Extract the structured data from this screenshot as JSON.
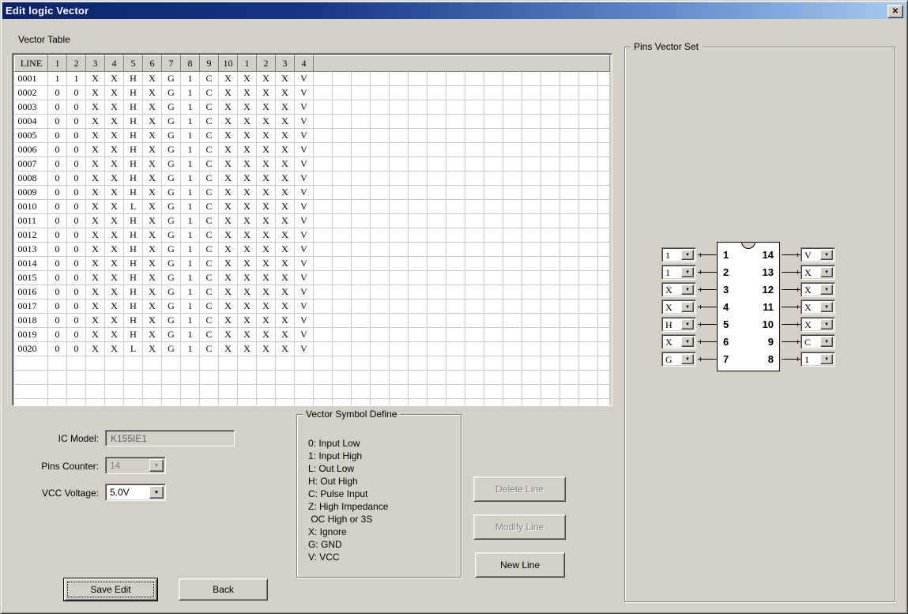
{
  "window": {
    "title": "Edit logic Vector",
    "close_label": "✕"
  },
  "vector_table": {
    "label": "Vector Table",
    "headers": [
      "LINE",
      "1",
      "2",
      "3",
      "4",
      "5",
      "6",
      "7",
      "8",
      "9",
      "10",
      "1",
      "2",
      "3",
      "4"
    ],
    "rows": [
      {
        "line": "0001",
        "values": [
          "1",
          "1",
          "X",
          "X",
          "H",
          "X",
          "G",
          "1",
          "C",
          "X",
          "X",
          "X",
          "X",
          "V"
        ]
      },
      {
        "line": "0002",
        "values": [
          "0",
          "0",
          "X",
          "X",
          "H",
          "X",
          "G",
          "1",
          "C",
          "X",
          "X",
          "X",
          "X",
          "V"
        ]
      },
      {
        "line": "0003",
        "values": [
          "0",
          "0",
          "X",
          "X",
          "H",
          "X",
          "G",
          "1",
          "C",
          "X",
          "X",
          "X",
          "X",
          "V"
        ]
      },
      {
        "line": "0004",
        "values": [
          "0",
          "0",
          "X",
          "X",
          "H",
          "X",
          "G",
          "1",
          "C",
          "X",
          "X",
          "X",
          "X",
          "V"
        ]
      },
      {
        "line": "0005",
        "values": [
          "0",
          "0",
          "X",
          "X",
          "H",
          "X",
          "G",
          "1",
          "C",
          "X",
          "X",
          "X",
          "X",
          "V"
        ]
      },
      {
        "line": "0006",
        "values": [
          "0",
          "0",
          "X",
          "X",
          "H",
          "X",
          "G",
          "1",
          "C",
          "X",
          "X",
          "X",
          "X",
          "V"
        ]
      },
      {
        "line": "0007",
        "values": [
          "0",
          "0",
          "X",
          "X",
          "H",
          "X",
          "G",
          "1",
          "C",
          "X",
          "X",
          "X",
          "X",
          "V"
        ]
      },
      {
        "line": "0008",
        "values": [
          "0",
          "0",
          "X",
          "X",
          "H",
          "X",
          "G",
          "1",
          "C",
          "X",
          "X",
          "X",
          "X",
          "V"
        ]
      },
      {
        "line": "0009",
        "values": [
          "0",
          "0",
          "X",
          "X",
          "H",
          "X",
          "G",
          "1",
          "C",
          "X",
          "X",
          "X",
          "X",
          "V"
        ]
      },
      {
        "line": "0010",
        "values": [
          "0",
          "0",
          "X",
          "X",
          "L",
          "X",
          "G",
          "1",
          "C",
          "X",
          "X",
          "X",
          "X",
          "V"
        ]
      },
      {
        "line": "0011",
        "values": [
          "0",
          "0",
          "X",
          "X",
          "H",
          "X",
          "G",
          "1",
          "C",
          "X",
          "X",
          "X",
          "X",
          "V"
        ]
      },
      {
        "line": "0012",
        "values": [
          "0",
          "0",
          "X",
          "X",
          "H",
          "X",
          "G",
          "1",
          "C",
          "X",
          "X",
          "X",
          "X",
          "V"
        ]
      },
      {
        "line": "0013",
        "values": [
          "0",
          "0",
          "X",
          "X",
          "H",
          "X",
          "G",
          "1",
          "C",
          "X",
          "X",
          "X",
          "X",
          "V"
        ]
      },
      {
        "line": "0014",
        "values": [
          "0",
          "0",
          "X",
          "X",
          "H",
          "X",
          "G",
          "1",
          "C",
          "X",
          "X",
          "X",
          "X",
          "V"
        ]
      },
      {
        "line": "0015",
        "values": [
          "0",
          "0",
          "X",
          "X",
          "H",
          "X",
          "G",
          "1",
          "C",
          "X",
          "X",
          "X",
          "X",
          "V"
        ]
      },
      {
        "line": "0016",
        "values": [
          "0",
          "0",
          "X",
          "X",
          "H",
          "X",
          "G",
          "1",
          "C",
          "X",
          "X",
          "X",
          "X",
          "V"
        ]
      },
      {
        "line": "0017",
        "values": [
          "0",
          "0",
          "X",
          "X",
          "H",
          "X",
          "G",
          "1",
          "C",
          "X",
          "X",
          "X",
          "X",
          "V"
        ]
      },
      {
        "line": "0018",
        "values": [
          "0",
          "0",
          "X",
          "X",
          "H",
          "X",
          "G",
          "1",
          "C",
          "X",
          "X",
          "X",
          "X",
          "V"
        ]
      },
      {
        "line": "0019",
        "values": [
          "0",
          "0",
          "X",
          "X",
          "H",
          "X",
          "G",
          "1",
          "C",
          "X",
          "X",
          "X",
          "X",
          "V"
        ]
      },
      {
        "line": "0020",
        "values": [
          "0",
          "0",
          "X",
          "X",
          "L",
          "X",
          "G",
          "1",
          "C",
          "X",
          "X",
          "X",
          "X",
          "V"
        ]
      }
    ],
    "empty_rows": 4,
    "data_columns": 29
  },
  "form": {
    "ic_model": {
      "label": "IC Model:",
      "value": "K155IE1"
    },
    "pins_counter": {
      "label": "Pins Counter:",
      "value": "14"
    },
    "vcc_voltage": {
      "label": "VCC Voltage:",
      "value": "5.0V"
    }
  },
  "symbol_define": {
    "title": "Vector Symbol Define",
    "lines": [
      "0: Input Low",
      "1: Input High",
      "L: Out Low",
      "H: Out High",
      "C: Pulse Input",
      "Z: High Impedance",
      " OC High or 3S",
      "X: Ignore",
      "G: GND",
      "V: VCC"
    ]
  },
  "actions": {
    "delete_line": "Delete Line",
    "modify_line": "Modify Line",
    "new_line": "New Line",
    "save_edit": "Save Edit",
    "back": "Back"
  },
  "pins_vector_set": {
    "title": "Pins Vector Set",
    "left_pins": [
      {
        "pin": "1",
        "value": "1"
      },
      {
        "pin": "2",
        "value": "1"
      },
      {
        "pin": "3",
        "value": "X"
      },
      {
        "pin": "4",
        "value": "X"
      },
      {
        "pin": "5",
        "value": "H"
      },
      {
        "pin": "6",
        "value": "X"
      },
      {
        "pin": "7",
        "value": "G"
      }
    ],
    "right_pins": [
      {
        "pin": "14",
        "value": "V"
      },
      {
        "pin": "13",
        "value": "X"
      },
      {
        "pin": "12",
        "value": "X"
      },
      {
        "pin": "11",
        "value": "X"
      },
      {
        "pin": "10",
        "value": "X"
      },
      {
        "pin": "9",
        "value": "C"
      },
      {
        "pin": "8",
        "value": "1"
      }
    ]
  },
  "colors": {
    "titlebar_start": "#0a246a",
    "titlebar_end": "#a6caf0",
    "face": "#d4d0c8",
    "grid_line": "#c9c9c9",
    "disabled_text": "#808080"
  }
}
